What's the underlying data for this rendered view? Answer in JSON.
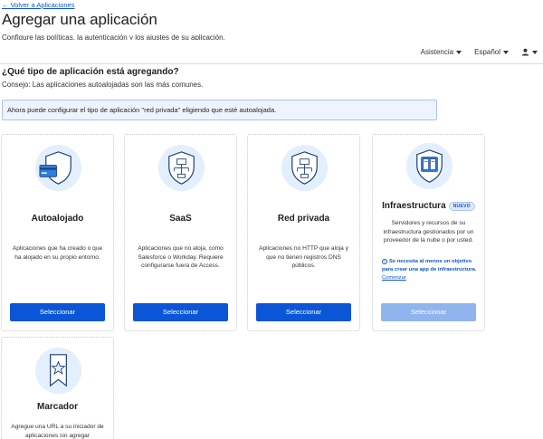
{
  "header": {
    "back_link": "← Volver a Aplicaciones",
    "title": "Agregar una aplicación",
    "subtitle": "Configure las políticas, la autenticación y los ajustes de su aplicación."
  },
  "topnav": {
    "help": "Asistencia",
    "language": "Español",
    "user_icon": "user-icon"
  },
  "section": {
    "heading": "¿Qué tipo de aplicación está agregando?",
    "tip": "Consejo: Las aplicaciones autoalojadas son las más comunes."
  },
  "banner": {
    "text": "Ahora puede configurar el tipo de aplicación \"red privada\" eligiendo que esté autoalojada."
  },
  "cards": [
    {
      "title": "Autoalojado",
      "description": "Aplicaciones que ha creado o que ha alojado en su propio entorno.",
      "button": "Seleccionar",
      "icon": "shield-card-icon"
    },
    {
      "title": "SaaS",
      "description": "Aplicaciones que no aloja, como Salesforce o Workday. Requiere configurarse fuera de Access.",
      "button": "Seleccionar",
      "icon": "shield-network-icon"
    },
    {
      "title": "Red privada",
      "description": "Aplicaciones no HTTP que aloja y que no tienen registros DNS públicos.",
      "button": "Seleccionar",
      "icon": "shield-network-icon"
    },
    {
      "title": "Infraestructura",
      "badge": "NUEVO",
      "description": "Servidores y recursos de su infraestructura gestionados por un proveedor de la nube o por usted.",
      "note": "Se necesita al menos un objetivo para crear una app de infraestructura.",
      "note_link": "Comenzar",
      "button": "Seleccionar",
      "button_disabled": true,
      "icon": "shield-server-icon"
    },
    {
      "title": "Marcador",
      "description": "Agregue una URL a su iniciador de aplicaciones sin agregar",
      "icon": "bookmark-star-icon"
    }
  ],
  "colors": {
    "accent": "#0a56d6",
    "accent_disabled": "#8fb4ee",
    "banner_bg": "#eef4fe",
    "icon_circle": "#e3effc"
  }
}
